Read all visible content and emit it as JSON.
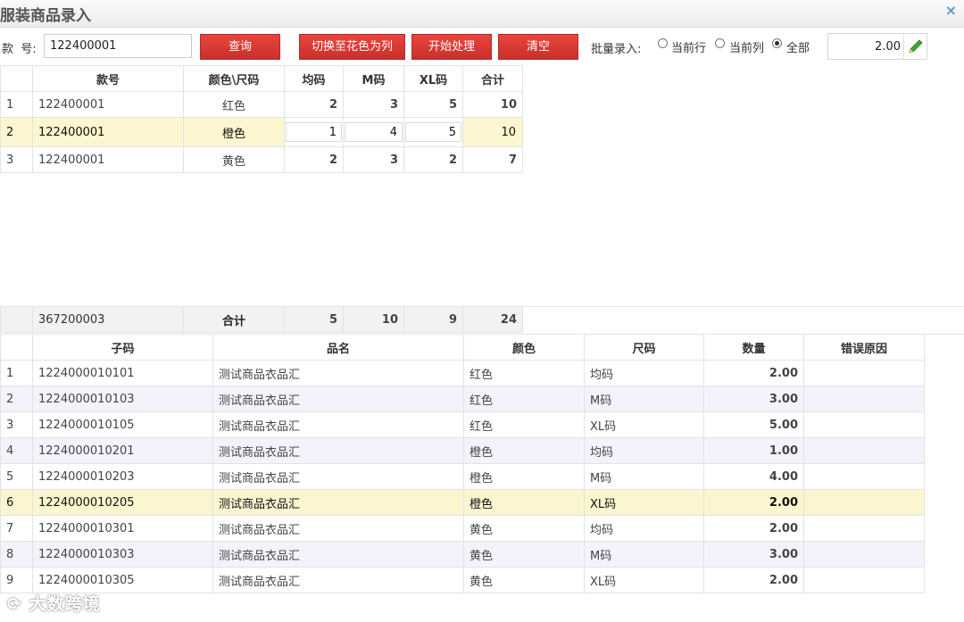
{
  "window": {
    "title": "服装商品录入",
    "close": "×"
  },
  "toolbar": {
    "style_label": "款  号:",
    "style_value": "122400001",
    "query": "查询",
    "switch": "切换至花色为列",
    "start": "开始处理",
    "clear": "清空",
    "batch_label": "批量录入:",
    "opt_row": "当前行",
    "opt_col": "当前列",
    "opt_all": "全部",
    "batch_value": "2.00"
  },
  "matrix": {
    "headers": [
      "款号",
      "颜色\\尺码",
      "均码",
      "M码",
      "XL码",
      "合计"
    ],
    "rows": [
      {
        "n": "1",
        "style": "122400001",
        "color": "红色",
        "v1": "2",
        "v2": "3",
        "v3": "5",
        "total": "10"
      },
      {
        "n": "2",
        "style": "122400001",
        "color": "橙色",
        "v1": "1",
        "v2": "4",
        "v3": "5",
        "total": "10"
      },
      {
        "n": "3",
        "style": "122400001",
        "color": "黄色",
        "v1": "2",
        "v2": "3",
        "v3": "2",
        "total": "7"
      }
    ],
    "summary": {
      "code": "367200003",
      "label": "合计",
      "v1": "5",
      "v2": "10",
      "v3": "9",
      "total": "24"
    }
  },
  "detail": {
    "headers": [
      "子码",
      "品名",
      "颜色",
      "尺码",
      "数量",
      "错误原因"
    ],
    "rows": [
      {
        "n": "1",
        "sub": "1224000010101",
        "name": "测试商品衣品汇",
        "color": "红色",
        "size": "均码",
        "qty": "2.00"
      },
      {
        "n": "2",
        "sub": "1224000010103",
        "name": "测试商品衣品汇",
        "color": "红色",
        "size": "M码",
        "qty": "3.00"
      },
      {
        "n": "3",
        "sub": "1224000010105",
        "name": "测试商品衣品汇",
        "color": "红色",
        "size": "XL码",
        "qty": "5.00"
      },
      {
        "n": "4",
        "sub": "1224000010201",
        "name": "测试商品衣品汇",
        "color": "橙色",
        "size": "均码",
        "qty": "1.00"
      },
      {
        "n": "5",
        "sub": "1224000010203",
        "name": "测试商品衣品汇",
        "color": "橙色",
        "size": "M码",
        "qty": "4.00"
      },
      {
        "n": "6",
        "sub": "1224000010205",
        "name": "测试商品衣品汇",
        "color": "橙色",
        "size": "XL码",
        "qty": "2.00"
      },
      {
        "n": "7",
        "sub": "1224000010301",
        "name": "测试商品衣品汇",
        "color": "黄色",
        "size": "均码",
        "qty": "2.00"
      },
      {
        "n": "8",
        "sub": "1224000010303",
        "name": "测试商品衣品汇",
        "color": "黄色",
        "size": "M码",
        "qty": "3.00"
      },
      {
        "n": "9",
        "sub": "1224000010305",
        "name": "测试商品衣品汇",
        "color": "黄色",
        "size": "XL码",
        "qty": "2.00"
      }
    ]
  },
  "watermark": "大数跨境",
  "colors": {
    "button": "#d9362f",
    "selected_row": "#fbf6cf",
    "alt_row": "#f3f3fc",
    "pencil": "#3aa63a"
  }
}
